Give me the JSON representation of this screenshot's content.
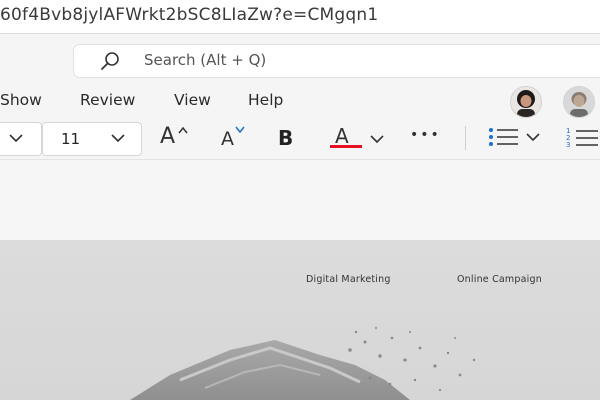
{
  "browser": {
    "url_fragment": "60f4Bvb8jylAFWrkt2bSC8LIaZw?e=CMgqn1"
  },
  "search": {
    "placeholder": "Search (Alt + Q)"
  },
  "menu": {
    "items": [
      "Show",
      "Review",
      "View",
      "Help"
    ]
  },
  "toolbar": {
    "font_size": "11",
    "grow_font_label": "A",
    "shrink_font_label": "A",
    "bold_label": "B",
    "font_color_label": "A",
    "font_color_accent": "#e81123",
    "more_label": "•••"
  },
  "document": {
    "nav_items": [
      "Digital Marketing",
      "Online Campaign"
    ]
  },
  "icons": [
    "search-icon",
    "chevron-down-icon",
    "grow-font-icon",
    "shrink-font-icon",
    "bold-icon",
    "font-color-icon",
    "more-icon",
    "bullets-icon",
    "numbering-icon",
    "avatar"
  ]
}
